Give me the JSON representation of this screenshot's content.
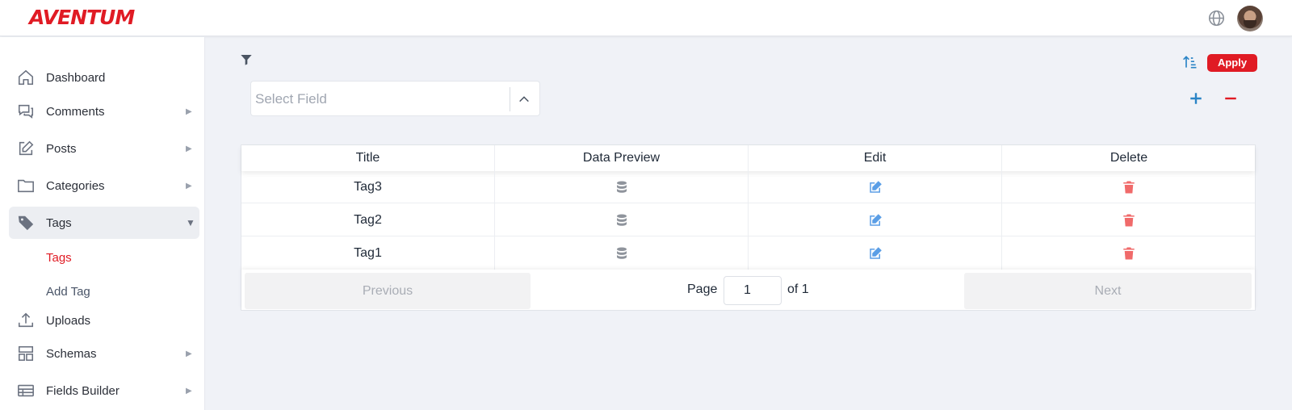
{
  "header": {
    "logo_text": "AVENTUM",
    "globe_icon": "globe-icon",
    "avatar": "user-avatar"
  },
  "sidebar": {
    "items": [
      {
        "label": "Dashboard",
        "icon": "home-icon",
        "has_arrow": false
      },
      {
        "label": "Comments",
        "icon": "comments-icon",
        "has_arrow": true
      },
      {
        "label": "Posts",
        "icon": "edit-icon",
        "has_arrow": true
      },
      {
        "label": "Categories",
        "icon": "folder-icon",
        "has_arrow": true
      },
      {
        "label": "Tags",
        "icon": "tag-icon",
        "has_arrow": true,
        "expanded": true
      },
      {
        "label": "Uploads",
        "icon": "upload-icon",
        "has_arrow": false
      },
      {
        "label": "Schemas",
        "icon": "layout-icon",
        "has_arrow": true
      },
      {
        "label": "Fields Builder",
        "icon": "table-icon",
        "has_arrow": true
      }
    ],
    "tags_subitems": [
      {
        "label": "Tags",
        "current": true
      },
      {
        "label": "Add Tag",
        "current": false
      }
    ]
  },
  "filter": {
    "select_placeholder": "Select Field",
    "apply_label": "Apply"
  },
  "table": {
    "columns": [
      "Title",
      "Data Preview",
      "Edit",
      "Delete"
    ],
    "rows": [
      {
        "title": "Tag3"
      },
      {
        "title": "Tag2"
      },
      {
        "title": "Tag1"
      }
    ]
  },
  "pagination": {
    "previous_label": "Previous",
    "next_label": "Next",
    "page_label": "Page",
    "page_value": "1",
    "of_label": "of 1"
  },
  "colors": {
    "accent": "#e01b24",
    "edit_icon": "#5b9ee6",
    "delete_icon": "#f06a6a",
    "db_icon": "#8f949c",
    "plus_icon": "#2a84c6"
  }
}
